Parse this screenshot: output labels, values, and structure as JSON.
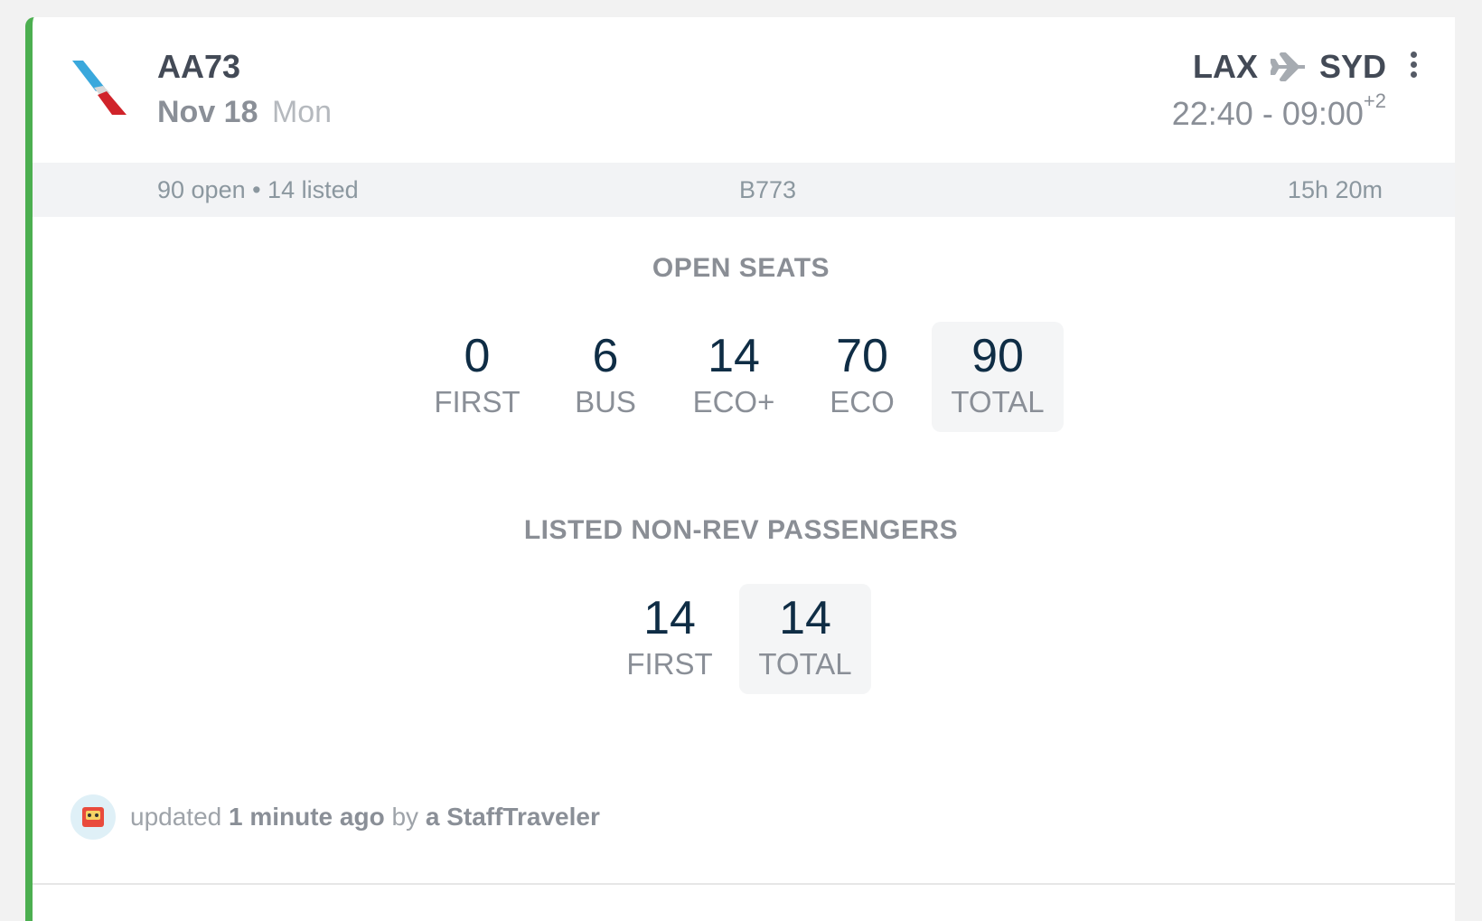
{
  "flight": {
    "number": "AA73",
    "date": "Nov 18",
    "weekday": "Mon",
    "origin": "LAX",
    "destination": "SYD",
    "times": "22:40 - 09:00",
    "day_offset": "+2"
  },
  "info_bar": {
    "summary": "90 open • 14 listed",
    "aircraft": "B773",
    "duration": "15h 20m"
  },
  "open_seats": {
    "title": "OPEN SEATS",
    "items": [
      {
        "value": "0",
        "label": "FIRST"
      },
      {
        "value": "6",
        "label": "BUS"
      },
      {
        "value": "14",
        "label": "ECO+"
      },
      {
        "value": "70",
        "label": "ECO"
      },
      {
        "value": "90",
        "label": "TOTAL"
      }
    ]
  },
  "listed": {
    "title": "LISTED NON-REV PASSENGERS",
    "items": [
      {
        "value": "14",
        "label": "FIRST"
      },
      {
        "value": "14",
        "label": "TOTAL"
      }
    ]
  },
  "footer": {
    "prefix": "updated",
    "time": "1 minute ago",
    "by": "by",
    "author": "a StaffTraveler"
  },
  "colors": {
    "accent_border": "#4caf50",
    "value_text": "#0f2d45"
  },
  "icons": [
    "airline-logo-icon",
    "plane-icon",
    "more-vertical-icon",
    "avatar-icon"
  ]
}
